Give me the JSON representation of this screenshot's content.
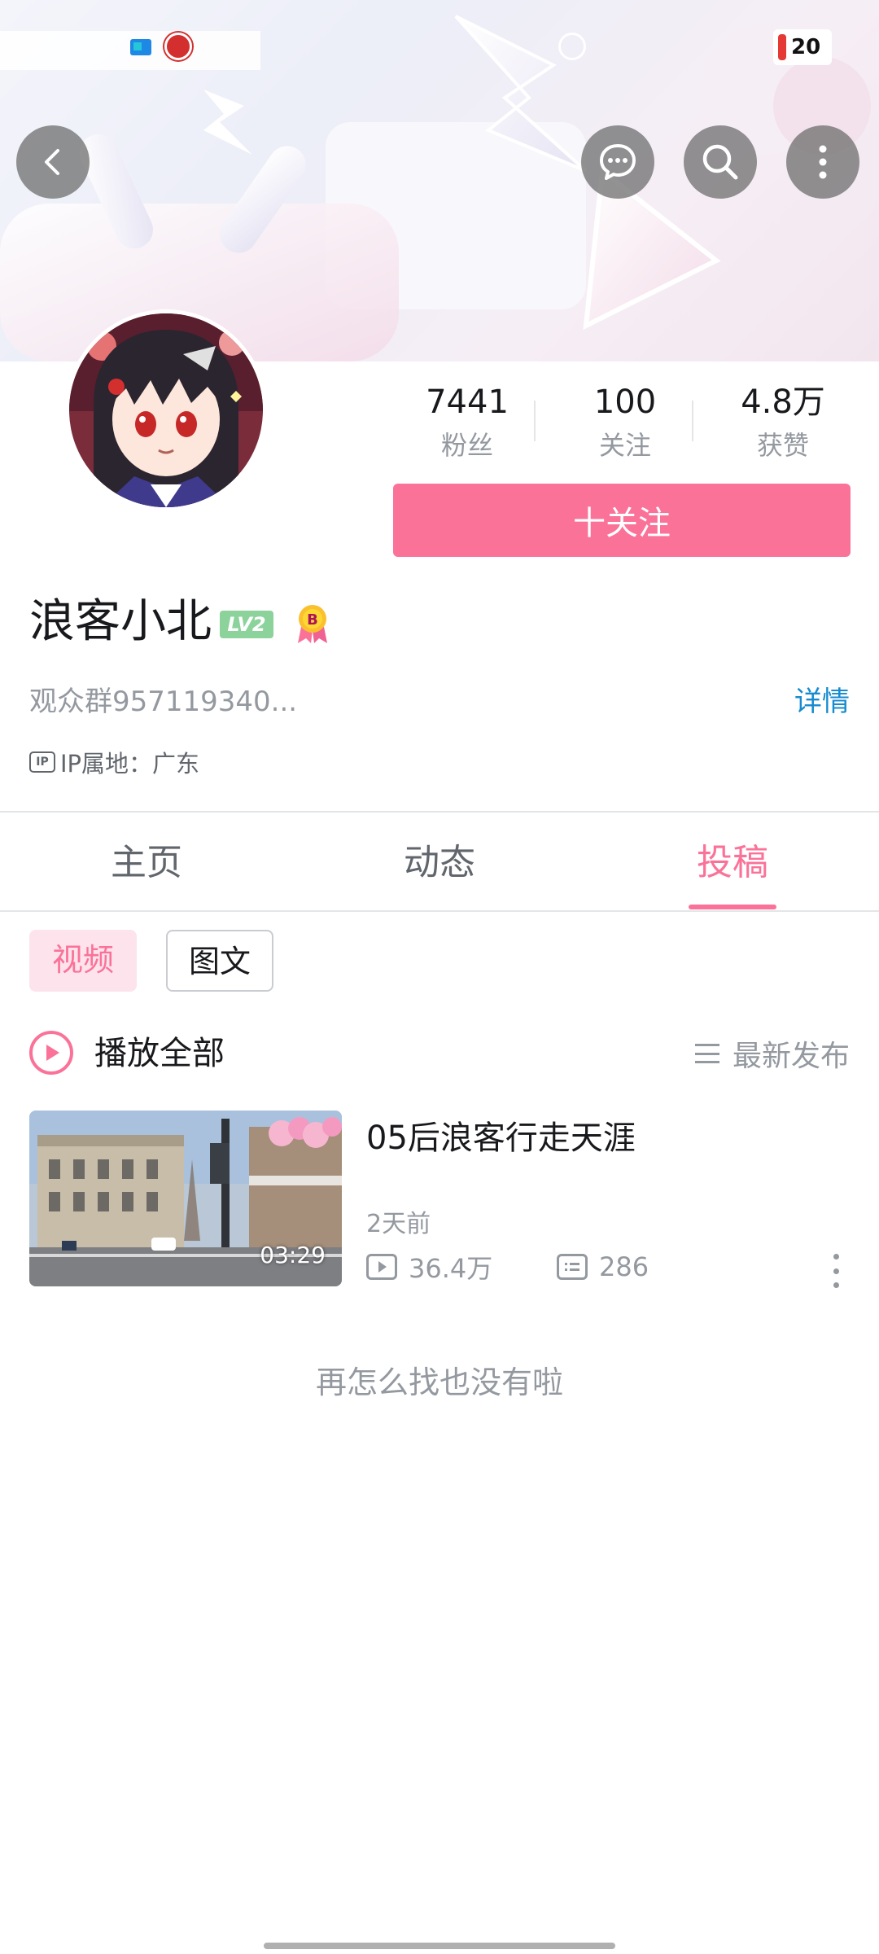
{
  "status_bar": {
    "battery_level": "20"
  },
  "profile": {
    "name": "浪客小北",
    "level_badge": "LV2",
    "bio": "观众群957119340...",
    "detail_link": "详情",
    "ip_icon": "IP",
    "ip_location": "IP属地：广东",
    "follow_button": "十关注"
  },
  "stats": [
    {
      "value": "7441",
      "label": "粉丝"
    },
    {
      "value": "100",
      "label": "关注"
    },
    {
      "value": "4.8万",
      "label": "获赞"
    }
  ],
  "tabs": [
    {
      "label": "主页",
      "active": false
    },
    {
      "label": "动态",
      "active": false
    },
    {
      "label": "投稿",
      "active": true
    }
  ],
  "filters": {
    "video": "视频",
    "text": "图文"
  },
  "list_header": {
    "play_all": "播放全部",
    "sort": "最新发布"
  },
  "videos": [
    {
      "title": "05后浪客行走天涯",
      "duration": "03:29",
      "time": "2天前",
      "views": "36.4万",
      "comments": "286"
    }
  ],
  "empty_text": "再怎么找也没有啦",
  "colors": {
    "accent": "#fb7299",
    "link": "#178bcf",
    "muted": "#9499a0"
  },
  "icons": [
    "back-icon",
    "chat-bubble-icon",
    "search-icon",
    "more-vertical-icon",
    "play-circle-icon",
    "sort-list-icon",
    "play-count-icon",
    "comment-icon"
  ]
}
